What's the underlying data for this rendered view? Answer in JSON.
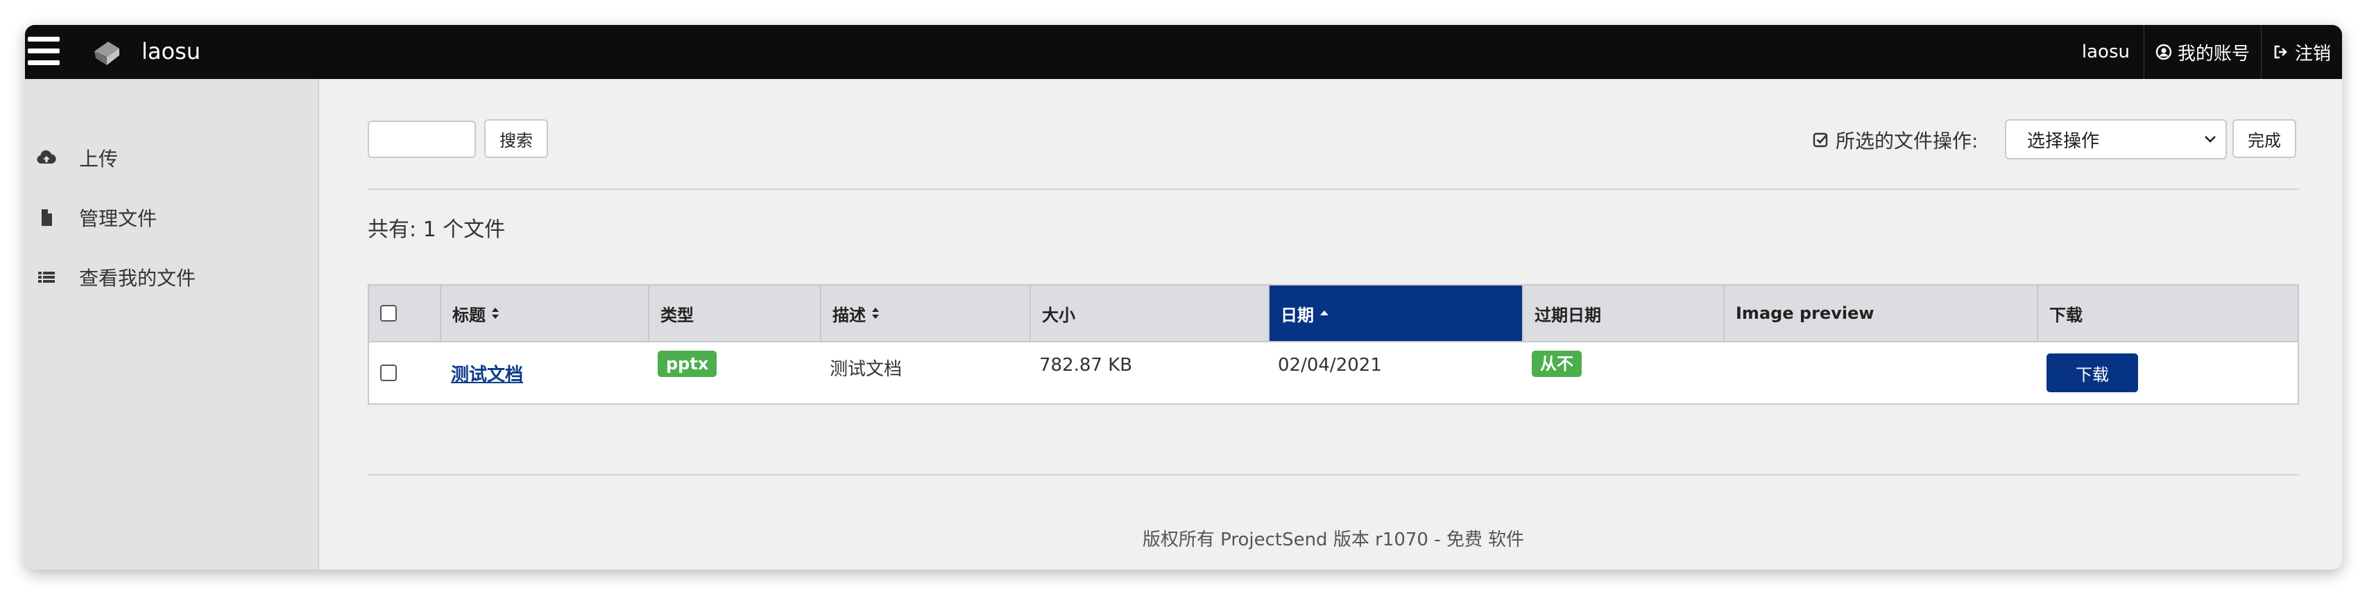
{
  "topbar": {
    "brand": "laosu",
    "user": "laosu",
    "account_label": "我的账号",
    "logout_label": "注销"
  },
  "sidebar": {
    "items": [
      {
        "label": "上传",
        "icon": "cloud-upload-icon"
      },
      {
        "label": "管理文件",
        "icon": "file-icon"
      },
      {
        "label": "查看我的文件",
        "icon": "list-icon"
      }
    ]
  },
  "toolbar": {
    "search_value": "",
    "search_button": "搜索",
    "bulk_label": "所选的文件操作:",
    "bulk_select_value": "选择操作",
    "done_button": "完成"
  },
  "summary": {
    "count_text": "共有: 1 个文件"
  },
  "table": {
    "headers": [
      "标题",
      "类型",
      "描述",
      "大小",
      "日期",
      "过期日期",
      "Image preview",
      "下载"
    ],
    "sorted_column": "日期",
    "rows": [
      {
        "title": "测试文档",
        "type": "pptx",
        "description": "测试文档",
        "size": "782.87 KB",
        "date": "02/04/2021",
        "expiry": "从不",
        "image_preview": "",
        "download_label": "下载"
      }
    ]
  },
  "footer": {
    "text": "版权所有 ProjectSend 版本 r1070 - 免费 软件"
  },
  "colors": {
    "topbar": "#0d0d0f",
    "accent": "#063383",
    "badge_green": "#4cae4c",
    "sidebar": "#e2e2e4",
    "content": "#f0f0f0"
  }
}
